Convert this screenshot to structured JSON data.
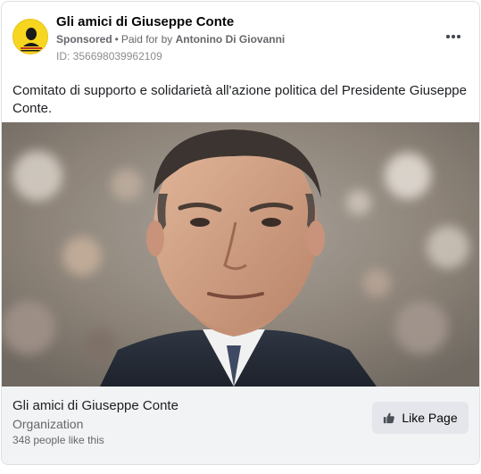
{
  "header": {
    "page_name": "Gli amici di Giuseppe Conte",
    "sponsored_label": "Sponsored",
    "separator": "•",
    "paid_for_prefix": "Paid for by",
    "paid_for_name": "Antonino Di Giovanni",
    "ad_id": "ID: 356698039962109",
    "more_icon": "more-horizontal-icon",
    "avatar_text_line1": "GLI AMICI DI",
    "avatar_text_line2": "GIUSEPPE CONTE"
  },
  "post": {
    "text": "Comitato di supporto e solidarietà all'azione politica del Presidente Giuseppe Conte."
  },
  "footer": {
    "title": "Gli amici di Giuseppe Conte",
    "category": "Organization",
    "likes": "348 people like this",
    "like_button_label": "Like Page",
    "like_icon": "thumbs-up-icon"
  },
  "colors": {
    "avatar_bg": "#f7d61f",
    "footer_bg": "#f2f3f5",
    "button_bg": "#e4e6eb",
    "secondary_text": "#65676b"
  }
}
